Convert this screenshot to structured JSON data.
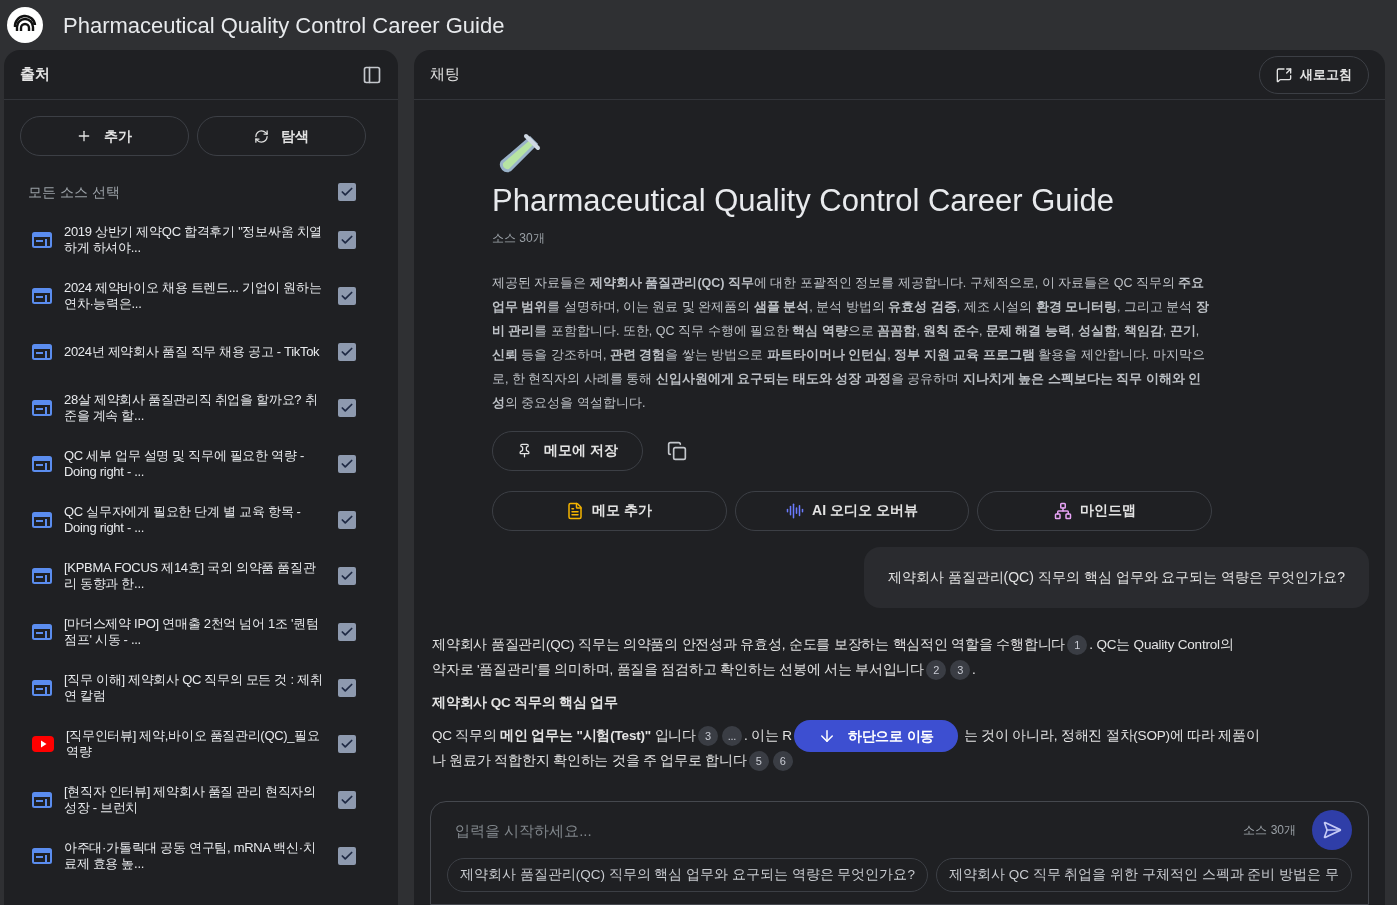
{
  "window": {
    "title": "Pharmaceutical Quality Control Career Guide"
  },
  "sources": {
    "title": "출처",
    "add_button": "추가",
    "explore_button": "탐색",
    "select_all": {
      "label": "모든 소스 선택",
      "checked": true
    },
    "items": [
      {
        "kind": "web",
        "label": "2019 상반기 제약QC 합격후기 \"정보싸움 치열하게 하셔야...",
        "checked": true
      },
      {
        "kind": "web",
        "label": "2024 제약바이오 채용 트렌드... 기업이 원하는 연차·능력은...",
        "checked": true
      },
      {
        "kind": "web",
        "label": "2024년 제약회사 품질 직무 채용 공고 - TikTok",
        "checked": true
      },
      {
        "kind": "web",
        "label": "28살 제약회사 품질관리직 취업을 할까요? 취준을 계속 할...",
        "checked": true
      },
      {
        "kind": "web",
        "label": "QC 세부 업무 설명 및 직무에 필요한 역량 - Doing right - ...",
        "checked": true
      },
      {
        "kind": "web",
        "label": "QC 실무자에게 필요한 단계 별 교육 항목 - Doing right - ...",
        "checked": true
      },
      {
        "kind": "web",
        "label": "[KPBMA FOCUS 제14호] 국외 의약품 품질관리 동향과 한...",
        "checked": true
      },
      {
        "kind": "web",
        "label": "[마더스제약 IPO] 연매출 2천억 넘어 1조 '퀀텀점프' 시동 - ...",
        "checked": true
      },
      {
        "kind": "web",
        "label": "[직무 이해] 제약회사 QC 직무의 모든 것 : 제취연 칼럼",
        "checked": true
      },
      {
        "kind": "youtube",
        "label": "[직무인터뷰] 제약,바이오 품질관리(QC)_필요역량",
        "checked": true
      },
      {
        "kind": "web",
        "label": "[현직자 인터뷰] 제약회사 품질 관리 현직자의 성장 - 브런치",
        "checked": true
      },
      {
        "kind": "web",
        "label": "아주대·가톨릭대 공동 연구팀, mRNA 백신·치료제 효용 높...",
        "checked": true
      }
    ]
  },
  "chat": {
    "title": "채팅",
    "refresh_button": "새로고침",
    "notebook_title": "Pharmaceutical Quality Control Career Guide",
    "source_count": "소스 30개",
    "summary": "제공된 자료들은 **제약회사 품질관리(QC) 직무**에 대한 포괄적인 정보를 제공합니다. 구체적으로, 이 자료들은 QC 직무의 **주요 업무 범위**를 설명하며, 이는 원료 및 완제품의 **샘플 분석**, 분석 방법의 **유효성 검증**, 제조 시설의 **환경 모니터링**, 그리고 분석 **장비 관리**를 포함합니다. 또한, QC 직무 수행에 필요한 **핵심 역량**으로 **꼼꼼함**, **원칙 준수**, **문제 해결 능력**, **성실함**, **책임감**, **끈기**, **신뢰** 등을 강조하며, **관련 경험**을 쌓는 방법으로 **파트타이머나 인턴십**, **정부 지원 교육 프로그램** 활용을 제안합니다. 마지막으로, 한 현직자의 사례를 통해 **신입사원에게 요구되는 태도와 성장 과정**을 공유하며 **지나치게 높은 스펙보다는 직무 이해와 인성**의 중요성을 역설합니다.",
    "save_button": "메모에 저장",
    "actions": [
      {
        "kind": "note",
        "label": "메모 추가"
      },
      {
        "kind": "audio",
        "label": "AI 오디오 오버뷰"
      },
      {
        "kind": "mindmap",
        "label": "마인드맵"
      }
    ],
    "user_message": "제약회사 품질관리(QC) 직무의 핵심 업무와 요구되는 역량은 무엇인가요?",
    "answer": [
      {
        "kind": "para",
        "parts": [
          {
            "kind": "text",
            "text": "제약회사 품질관리(QC) 직무는 의약품의 안전성과 유효성, 순도를 보장하는 핵심적인 역할을 수행합니다"
          },
          {
            "kind": "cite",
            "text": "1"
          },
          {
            "kind": "text",
            "text": ". QC는 Quality Control의"
          },
          {
            "kind": "break"
          },
          {
            "kind": "text",
            "text": "약자로 '품질관리'를 의미하며, 품질을 점검하고 확인하는 선봉에 서는 부서입니다"
          },
          {
            "kind": "cite",
            "text": "2"
          },
          {
            "kind": "cite",
            "text": "3"
          },
          {
            "kind": "text",
            "text": "."
          }
        ]
      },
      {
        "kind": "heading",
        "parts": [
          {
            "kind": "text",
            "text": "제약회사 QC 직무의 핵심 업무"
          }
        ]
      },
      {
        "kind": "para",
        "parts": [
          {
            "kind": "text",
            "text": "QC 직무의 **메인 업무는 \"시험(Test)\"** 입니다"
          },
          {
            "kind": "cite",
            "text": "3"
          },
          {
            "kind": "cite",
            "text": "..."
          },
          {
            "kind": "text",
            "text": ". 이는 R"
          },
          {
            "kind": "gap"
          },
          {
            "kind": "text",
            "text": "는 것이 아니라, 정해진 절차(SOP)에 따라 제품이"
          },
          {
            "kind": "break"
          },
          {
            "kind": "text",
            "text": "나 원료가 적합한지 확인하는 것을 주 업무로 합니다"
          },
          {
            "kind": "cite",
            "text": "5"
          },
          {
            "kind": "cite",
            "text": "6"
          }
        ]
      }
    ],
    "scroll_button": "하단으로 이동",
    "input": {
      "placeholder": "입력을 시작하세요...",
      "source_count": "소스 30개"
    },
    "suggestions": [
      "제약회사 품질관리(QC) 직무의 핵심 업무와 요구되는 역량은 무엇인가요?",
      "제약회사 QC 직무 취업을 위한 구체적인 스펙과 준비 방법은 무"
    ]
  }
}
